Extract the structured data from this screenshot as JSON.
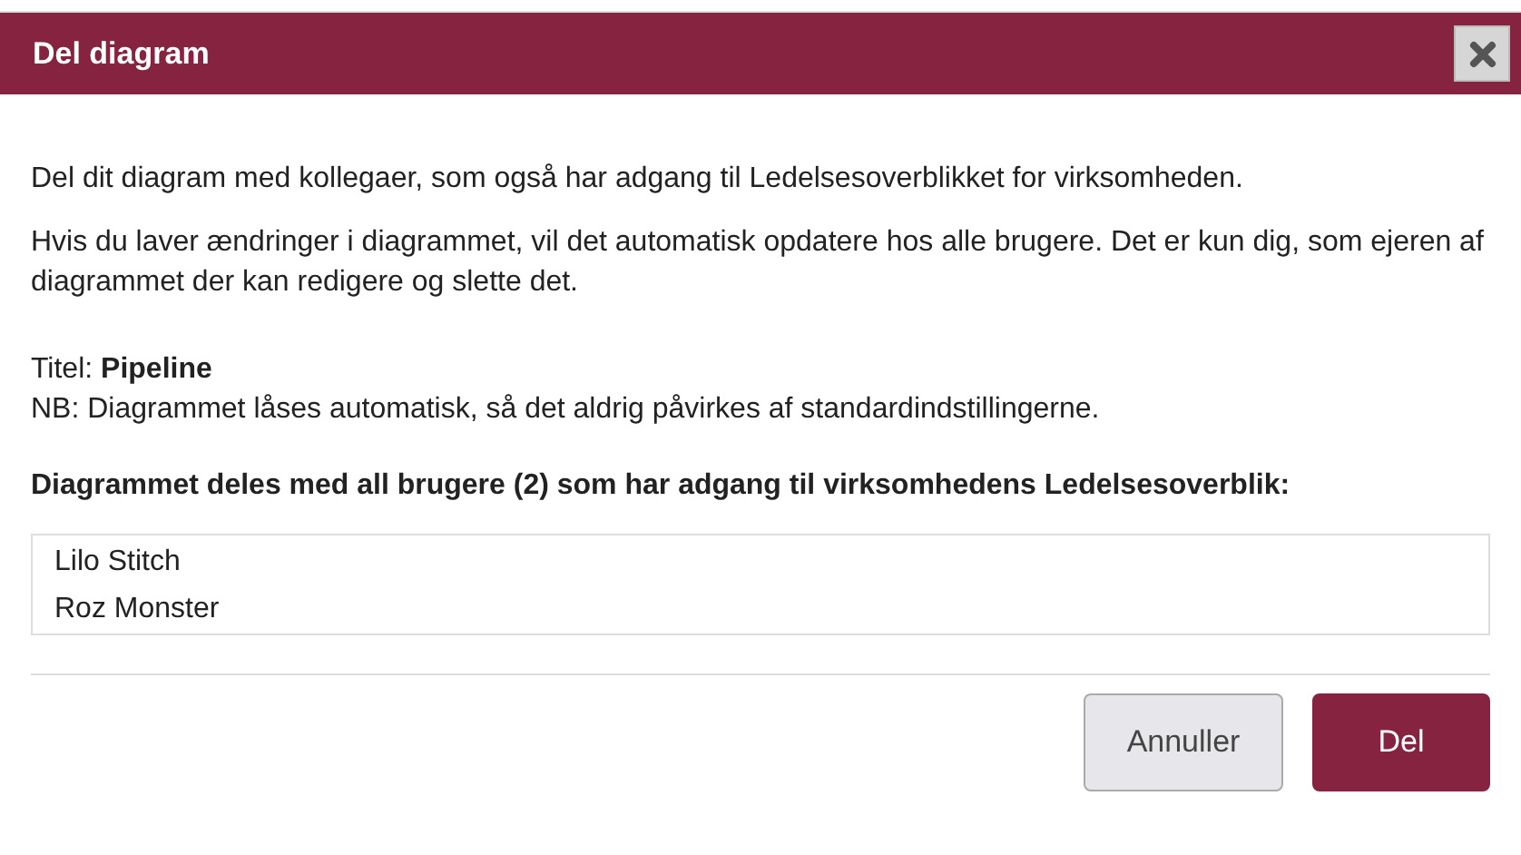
{
  "dialog": {
    "title": "Del diagram",
    "paragraphs": [
      "Del dit diagram med kollegaer, som også har adgang til Ledelsesoverblikket for virksomheden.",
      "Hvis du laver ændringer i diagrammet, vil det automatisk opdatere hos alle brugere. Det er kun dig, som ejeren af diagrammet der kan redigere og slette det."
    ],
    "details": [
      "Titel: **Pipeline**",
      "NB: Diagrammet låses automatisk, så det aldrig påvirkes af standardindstillingerne."
    ],
    "list_heading": "Diagrammet deles med all brugere (2) som har adgang til virksomhedens Ledelsesoverblik:",
    "users": [
      "Lilo Stitch",
      "Roz Monster"
    ],
    "buttons": [
      {
        "label": "Annuller",
        "kind": "secondary"
      },
      {
        "label": "Del",
        "kind": "primary"
      }
    ]
  }
}
